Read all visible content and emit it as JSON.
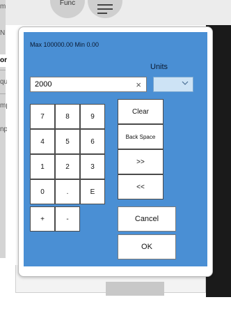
{
  "background": {
    "func_label": "Func",
    "side_labels": [
      "m",
      "N",
      "or",
      "qu",
      "mp",
      "np"
    ]
  },
  "dialog": {
    "range_text": "Max 100000.00  Min 0.00",
    "units_label": "Units",
    "value": "2000",
    "clear_icon": "×",
    "units_selected": "",
    "keypad": {
      "rows": [
        [
          "7",
          "8",
          "9"
        ],
        [
          "4",
          "5",
          "6"
        ],
        [
          "1",
          "2",
          "3"
        ],
        [
          "0",
          ".",
          "E"
        ]
      ],
      "plus": "+",
      "minus": "-"
    },
    "actions": {
      "clear": "Clear",
      "backspace": "Back Space",
      "forward": ">>",
      "back": "<<",
      "cancel": "Cancel",
      "ok": "OK"
    }
  }
}
